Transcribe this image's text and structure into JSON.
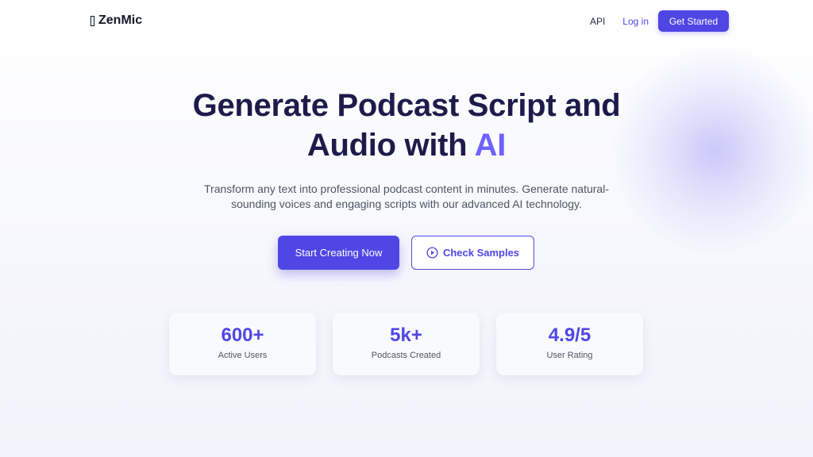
{
  "brand": {
    "name": "ZenMic",
    "icon": "app-icon"
  },
  "nav": {
    "api": "API",
    "login": "Log in",
    "get_started": "Get Started"
  },
  "hero": {
    "title_line1": "Generate Podcast Script and",
    "title_line2_prefix": "Audio with ",
    "title_line2_accent": "AI",
    "subtitle": "Transform any text into professional podcast content in minutes. Generate natural-sounding voices and engaging scripts with our advanced AI technology.",
    "primary_cta": "Start Creating Now",
    "secondary_cta": "Check Samples",
    "secondary_cta_icon": "play-circle-icon"
  },
  "stats": [
    {
      "value": "600+",
      "label": "Active Users"
    },
    {
      "value": "5k+",
      "label": "Podcasts Created"
    },
    {
      "value": "4.9/5",
      "label": "User Rating"
    }
  ],
  "colors": {
    "accent": "#4f46e5",
    "accent_light": "#6c63ff",
    "heading": "#1e1b4b"
  }
}
